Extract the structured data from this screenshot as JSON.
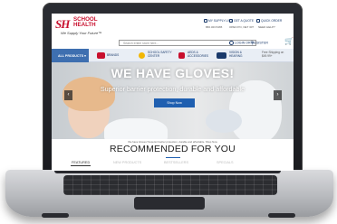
{
  "brand": {
    "logo_mark": "SH",
    "logo_line1": "SCHOOL",
    "logo_line2": "HEALTH",
    "tagline": "We Supply Your Future™",
    "color": "#c8102e"
  },
  "utility": {
    "supply_list": "MY SUPPLY LIST",
    "get_quote": "GET A QUOTE",
    "quick_order": "QUICK ORDER",
    "phone": "866.323.5465",
    "open_po": "OPEN PO, NET 30?",
    "need_help": "NEED HELP?"
  },
  "search": {
    "placeholder": "Search entire store here..."
  },
  "account": {
    "login_label": "LOGIN OR REGISTER"
  },
  "nav": {
    "all_products": "ALL PRODUCTS",
    "items": [
      {
        "line1": "BRANDS",
        "line2": ""
      },
      {
        "line1": "SCHOOL SAFETY",
        "line2": "CENTER"
      },
      {
        "line1": "AEDS &",
        "line2": "ACCESSORIES"
      },
      {
        "line1": "VISION &",
        "line2": "HEARING"
      },
      {
        "line1": "Free Shipping on",
        "line2": "$49.99+"
      }
    ]
  },
  "hero": {
    "title": "WE HAVE GLOVES!",
    "subtitle": "Superior barrier protection, durable and affordable",
    "button": "Shop Now",
    "caption": "We have Gloves! Superior barrier protection, durable and affordable. Shop Now",
    "prev_icon": "chevron-left-icon",
    "next_icon": "chevron-right-icon"
  },
  "recommended": {
    "title": "RECOMMENDED FOR YOU",
    "tabs": [
      "FEATURED",
      "NEW PRODUCTS",
      "BESTSELLERS",
      "SPECIALS"
    ]
  },
  "colors": {
    "navy": "#1a3a6b",
    "accent_blue": "#1f5fb0",
    "nav_all_bg": "#3e6fb0"
  }
}
